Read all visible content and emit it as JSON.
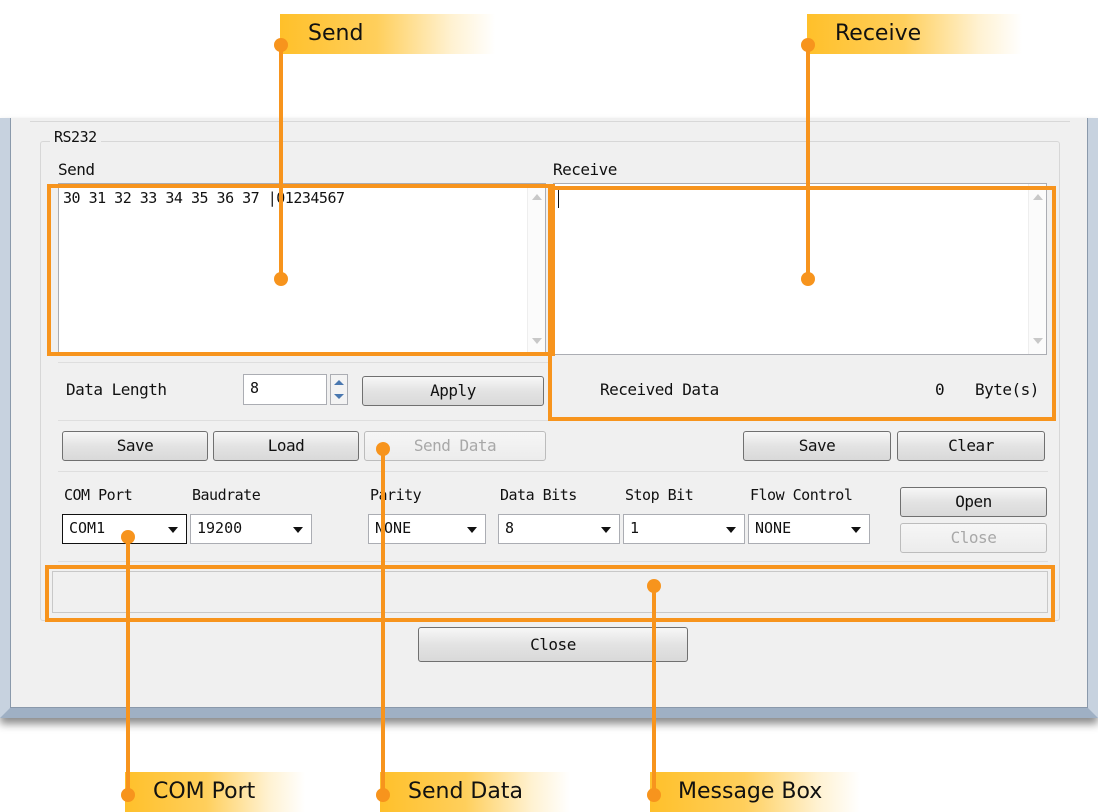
{
  "group": {
    "title": "RS232"
  },
  "send": {
    "label": "Send",
    "content": "30 31 32 33 34 35 36 37 |01234567"
  },
  "receive": {
    "label": "Receive",
    "content": "",
    "received_data_label": "Received Data",
    "received_count": "0",
    "received_unit": "Byte(s)"
  },
  "data_length": {
    "label": "Data Length",
    "value": "8",
    "apply_label": "Apply"
  },
  "send_buttons": {
    "save": "Save",
    "load": "Load",
    "send_data": "Send Data"
  },
  "receive_buttons": {
    "save": "Save",
    "clear": "Clear"
  },
  "serial": {
    "com_port": {
      "label": "COM Port",
      "value": "COM1"
    },
    "baudrate": {
      "label": "Baudrate",
      "value": "19200"
    },
    "parity": {
      "label": "Parity",
      "value": "NONE"
    },
    "data_bits": {
      "label": "Data Bits",
      "value": "8"
    },
    "stop_bit": {
      "label": "Stop Bit",
      "value": "1"
    },
    "flow_control": {
      "label": "Flow Control",
      "value": "NONE"
    },
    "open_label": "Open",
    "close_label": "Close"
  },
  "message_box": {
    "text": ""
  },
  "close_button": "Close",
  "annotations": {
    "send": "Send",
    "receive": "Receive",
    "com_port": "COM Port",
    "send_data": "Send Data",
    "message_box": "Message Box"
  },
  "colors": {
    "annotation": "#f7941d",
    "label_gradient": "#ffc02a"
  }
}
